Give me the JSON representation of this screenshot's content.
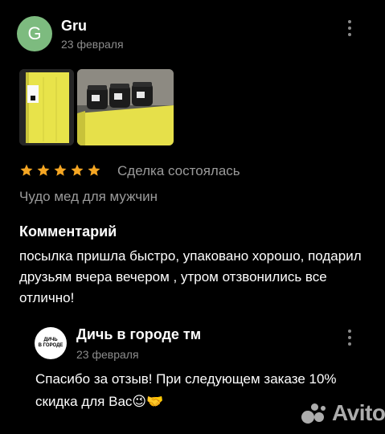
{
  "review": {
    "avatar_letter": "G",
    "author": "Gru",
    "date": "23 февраля",
    "rating": 5,
    "status": "Сделка состоялась",
    "item_title": "Чудо мед для мужчин",
    "comment_heading": "Комментарий",
    "comment_text": "посылка пришла быстро, упаковано хорошо, подарил друзьям вчера вечером , утром отзвонились все отлично!"
  },
  "reply": {
    "logo_text_1": "ДИЧЬ",
    "logo_text_2": "В ГОРОДЕ",
    "shop_name": "Дичь в городе тм",
    "date": "23 февраля",
    "text": "Спасибо за отзыв! При следующем заказе 10% скидка для Вас😉🤝"
  },
  "watermark": "Avito",
  "colors": {
    "avatar_bg": "#7dbb7f",
    "star": "#f5a623",
    "muted_text": "#9a9a9a",
    "background": "#000000"
  }
}
